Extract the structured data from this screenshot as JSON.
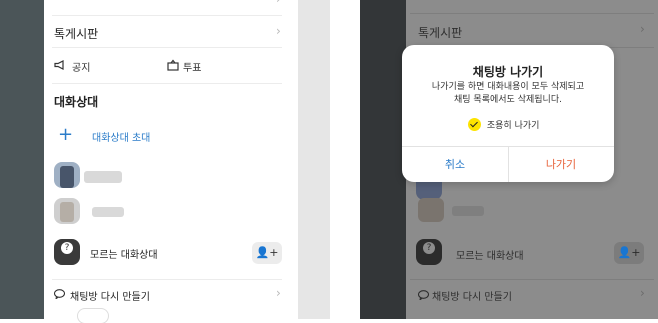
{
  "left": {
    "bulletin_label": "톡게시판",
    "notice_label": "공지",
    "vote_label": "투표",
    "section_title": "대화상대",
    "invite_label": "대화상대 초대",
    "unknown_label": "모르는 대화상대",
    "recreate_label": "채팅방 다시 만들기"
  },
  "right": {
    "bulletin_label": "톡게시판",
    "unknown_label": "모르는 대화상대",
    "recreate_label": "채팅방 다시 만들기"
  },
  "dialog": {
    "title": "채팅방 나가기",
    "message": "나가기를 하면 대화내용이 모두 삭제되고\n채팅 목록에서도 삭제됩니다.",
    "checkbox_label": "조용히 나가기",
    "checkbox_checked": true,
    "cancel_label": "취소",
    "leave_label": "나가기"
  },
  "colors": {
    "accent_blue": "#2b7cc9",
    "leave_orange": "#e8643c",
    "check_yellow": "#fde300"
  },
  "icons": [
    "chevron-right-icon",
    "megaphone-icon",
    "vote-icon",
    "plus-icon",
    "add-person-icon",
    "speech-bubble-icon",
    "check-icon"
  ]
}
